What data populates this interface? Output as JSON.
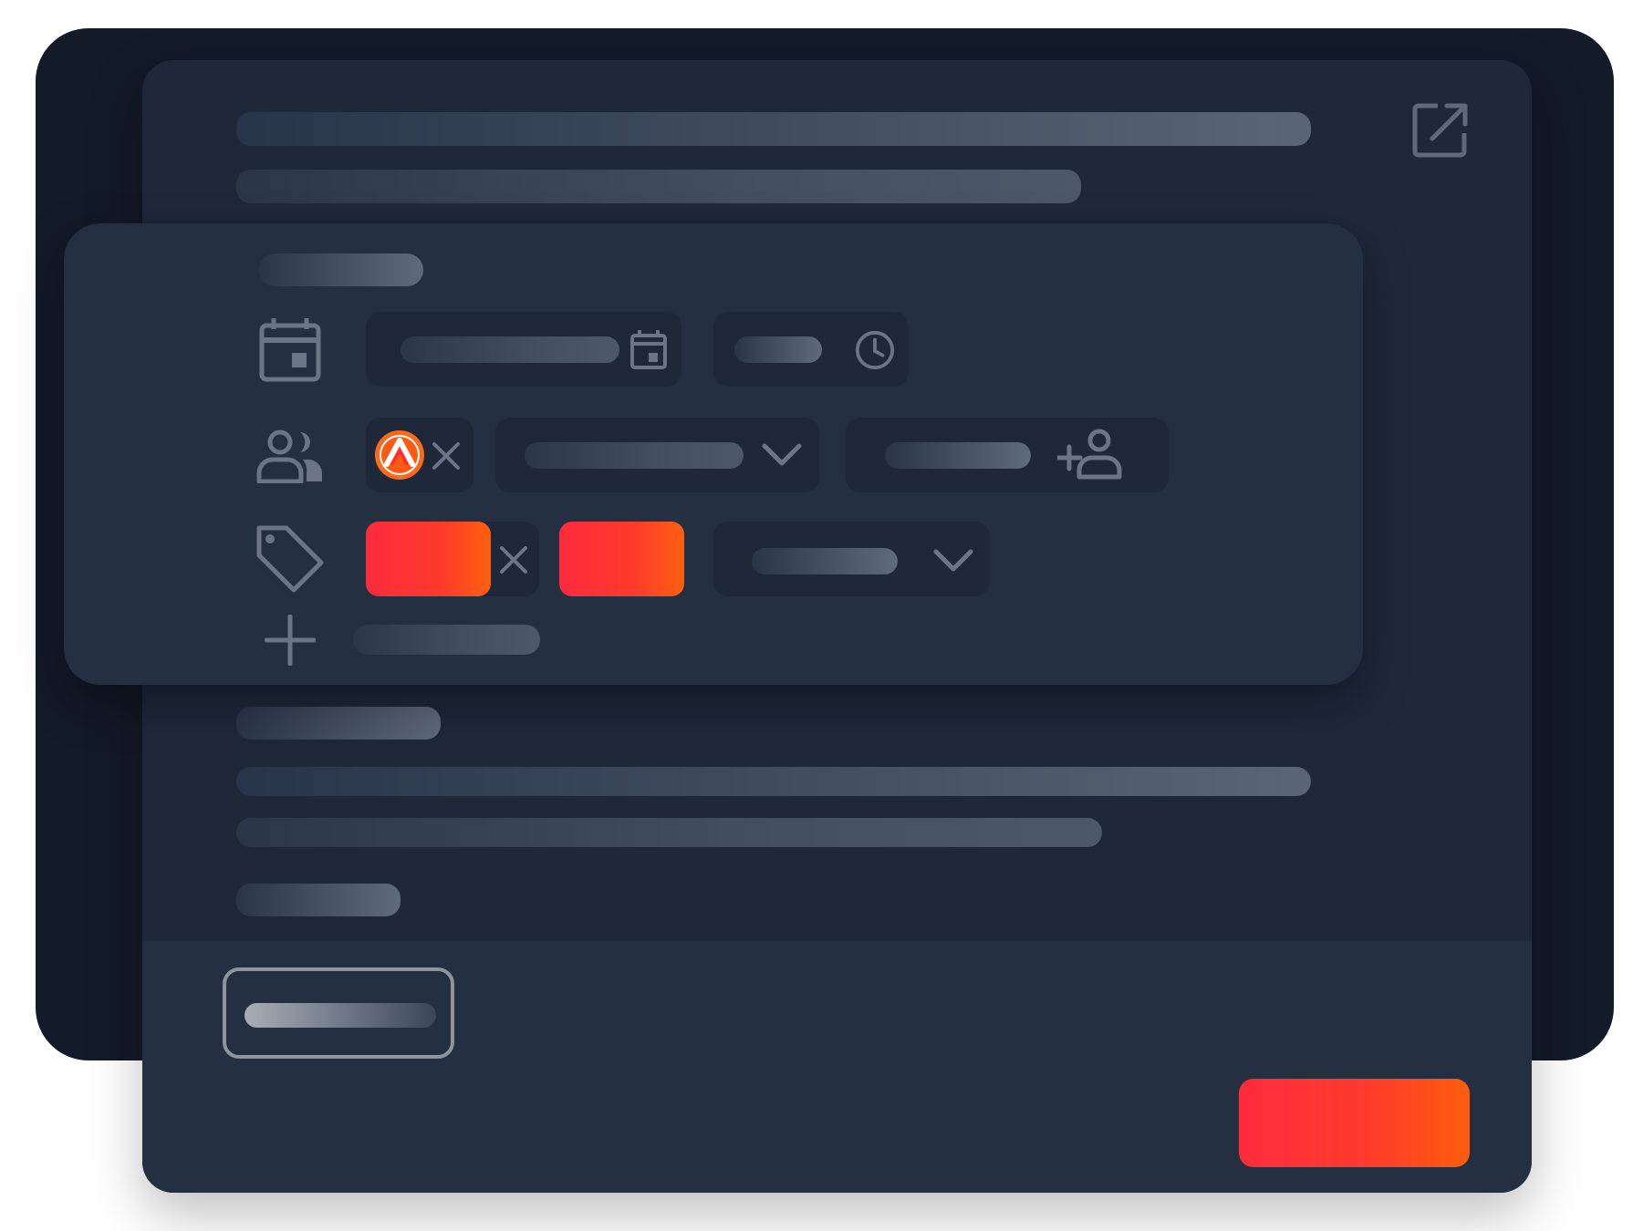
{
  "window": {
    "title": "",
    "external_link_icon": "external-link-icon"
  },
  "popup": {
    "date_row": {
      "icon": "calendar-icon",
      "date_value": "",
      "date_picker_icon": "calendar-small-icon",
      "time_value": "",
      "time_icon": "clock-icon"
    },
    "assignee_row": {
      "icon": "people-icon",
      "assignee_avatar": "brand-logo-avatar",
      "remove_icon": "close-icon",
      "dropdown_value": "",
      "dropdown_icon": "chevron-down-icon",
      "add_assignee_value": "",
      "add_assignee_icon": "add-person-icon"
    },
    "tags_row": {
      "icon": "tag-icon",
      "tags": [
        {
          "label": "",
          "color": "#ff2a3c"
        },
        {
          "label": "",
          "color": "#ff2a3c"
        }
      ],
      "remove_icon": "close-icon",
      "dropdown_value": "",
      "dropdown_icon": "chevron-down-icon"
    },
    "add_row": {
      "icon": "plus-icon",
      "label": ""
    }
  },
  "footer": {
    "secondary_button_label": "",
    "primary_button_label": ""
  },
  "colors": {
    "background_dark": "#131a28",
    "panel": "#1e2839",
    "popup": "#243041",
    "accent_start": "#ff2a3c",
    "accent_end": "#ff6010",
    "icon": "#6b7585"
  }
}
